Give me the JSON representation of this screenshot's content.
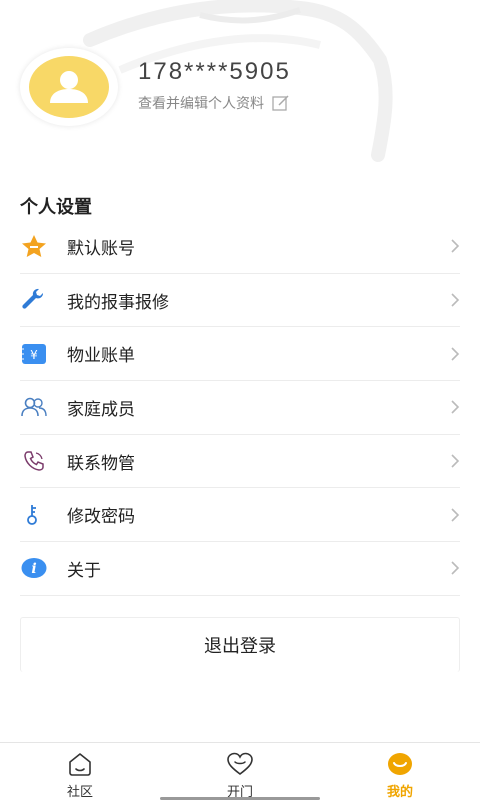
{
  "profile": {
    "phone": "178****5905",
    "edit_label": "查看并编辑个人资料"
  },
  "settings": {
    "title": "个人设置",
    "items": [
      {
        "label": "默认账号",
        "icon": "star-icon",
        "color": "#f3a320"
      },
      {
        "label": "我的报事报修",
        "icon": "wrench-icon",
        "color": "#2f7bd6"
      },
      {
        "label": "物业账单",
        "icon": "bill-icon",
        "color": "#3a8ff0"
      },
      {
        "label": "家庭成员",
        "icon": "family-icon",
        "color": "#4a7fc1"
      },
      {
        "label": "联系物管",
        "icon": "phone-icon",
        "color": "#7b3b6b"
      },
      {
        "label": "修改密码",
        "icon": "key-icon",
        "color": "#2f7bd6"
      },
      {
        "label": "关于",
        "icon": "info-icon",
        "color": "#3a8ff0"
      }
    ]
  },
  "logout_label": "退出登录",
  "tabbar": {
    "tabs": [
      {
        "label": "社区",
        "icon": "home-icon",
        "active": false
      },
      {
        "label": "开门",
        "icon": "heart-icon",
        "active": false
      },
      {
        "label": "我的",
        "icon": "smile-icon",
        "active": true
      }
    ]
  },
  "colors": {
    "accent": "#f0a500",
    "avatar_bg": "#f8d867"
  }
}
